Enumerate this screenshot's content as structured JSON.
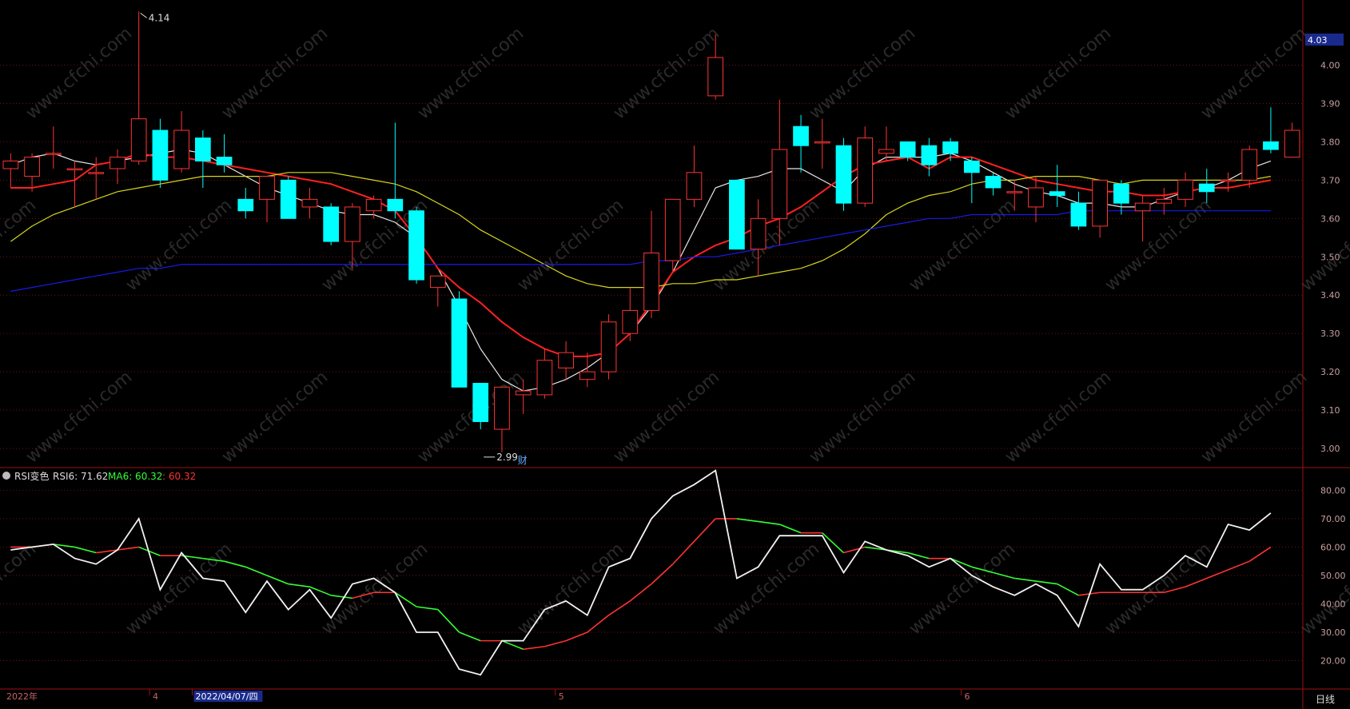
{
  "chart_data": {
    "type": "candlestick",
    "price_panel": {
      "ylim": [
        2.95,
        4.17
      ],
      "ticks": [
        4.0,
        3.9,
        3.8,
        3.7,
        3.6,
        3.5,
        3.4,
        3.3,
        3.2,
        3.1,
        3.0
      ],
      "tick_labels": [
        "4.00",
        "3.90",
        "3.80",
        "3.70",
        "3.60",
        "3.50",
        "3.40",
        "3.30",
        "3.20",
        "3.10",
        "3.00"
      ],
      "current_price_label": "4.03",
      "current_price": 4.03,
      "high_annotation": {
        "label": "4.14",
        "index": 6,
        "value": 4.14
      },
      "low_annotation": {
        "label": "2.99",
        "index": 22,
        "value": 2.99
      },
      "finance_marker": {
        "label": "财",
        "index": 24
      },
      "candles": [
        {
          "o": 3.73,
          "h": 3.77,
          "l": 3.68,
          "c": 3.75
        },
        {
          "o": 3.71,
          "h": 3.77,
          "l": 3.67,
          "c": 3.76
        },
        {
          "o": 3.77,
          "h": 3.84,
          "l": 3.73,
          "c": 3.77
        },
        {
          "o": 3.73,
          "h": 3.75,
          "l": 3.63,
          "c": 3.73
        },
        {
          "o": 3.72,
          "h": 3.76,
          "l": 3.65,
          "c": 3.72
        },
        {
          "o": 3.73,
          "h": 3.78,
          "l": 3.69,
          "c": 3.76
        },
        {
          "o": 3.75,
          "h": 4.14,
          "l": 3.74,
          "c": 3.86
        },
        {
          "o": 3.83,
          "h": 3.86,
          "l": 3.68,
          "c": 3.7
        },
        {
          "o": 3.73,
          "h": 3.88,
          "l": 3.72,
          "c": 3.83
        },
        {
          "o": 3.81,
          "h": 3.83,
          "l": 3.68,
          "c": 3.75
        },
        {
          "o": 3.76,
          "h": 3.82,
          "l": 3.72,
          "c": 3.74
        },
        {
          "o": 3.65,
          "h": 3.68,
          "l": 3.6,
          "c": 3.62
        },
        {
          "o": 3.65,
          "h": 3.71,
          "l": 3.59,
          "c": 3.71
        },
        {
          "o": 3.7,
          "h": 3.71,
          "l": 3.6,
          "c": 3.6
        },
        {
          "o": 3.63,
          "h": 3.68,
          "l": 3.6,
          "c": 3.65
        },
        {
          "o": 3.63,
          "h": 3.64,
          "l": 3.53,
          "c": 3.54
        },
        {
          "o": 3.54,
          "h": 3.64,
          "l": 3.47,
          "c": 3.63
        },
        {
          "o": 3.62,
          "h": 3.66,
          "l": 3.6,
          "c": 3.65
        },
        {
          "o": 3.65,
          "h": 3.85,
          "l": 3.6,
          "c": 3.62
        },
        {
          "o": 3.62,
          "h": 3.63,
          "l": 3.43,
          "c": 3.44
        },
        {
          "o": 3.42,
          "h": 3.45,
          "l": 3.37,
          "c": 3.45
        },
        {
          "o": 3.39,
          "h": 3.41,
          "l": 3.16,
          "c": 3.16
        },
        {
          "o": 3.17,
          "h": 3.16,
          "l": 3.05,
          "c": 3.07
        },
        {
          "o": 3.05,
          "h": 3.16,
          "l": 2.99,
          "c": 3.16
        },
        {
          "o": 3.14,
          "h": 3.18,
          "l": 3.09,
          "c": 3.15
        },
        {
          "o": 3.14,
          "h": 3.26,
          "l": 3.13,
          "c": 3.23
        },
        {
          "o": 3.21,
          "h": 3.28,
          "l": 3.18,
          "c": 3.25
        },
        {
          "o": 3.18,
          "h": 3.25,
          "l": 3.16,
          "c": 3.2
        },
        {
          "o": 3.2,
          "h": 3.35,
          "l": 3.18,
          "c": 3.33
        },
        {
          "o": 3.3,
          "h": 3.42,
          "l": 3.28,
          "c": 3.36
        },
        {
          "o": 3.36,
          "h": 3.62,
          "l": 3.34,
          "c": 3.51
        },
        {
          "o": 3.49,
          "h": 3.65,
          "l": 3.46,
          "c": 3.65
        },
        {
          "o": 3.65,
          "h": 3.79,
          "l": 3.63,
          "c": 3.72
        },
        {
          "o": 3.92,
          "h": 4.08,
          "l": 3.91,
          "c": 4.02
        },
        {
          "o": 3.7,
          "h": 3.7,
          "l": 3.52,
          "c": 3.52
        },
        {
          "o": 3.52,
          "h": 3.65,
          "l": 3.45,
          "c": 3.6
        },
        {
          "o": 3.6,
          "h": 3.91,
          "l": 3.53,
          "c": 3.78
        },
        {
          "o": 3.84,
          "h": 3.87,
          "l": 3.72,
          "c": 3.79
        },
        {
          "o": 3.8,
          "h": 3.86,
          "l": 3.73,
          "c": 3.8
        },
        {
          "o": 3.79,
          "h": 3.81,
          "l": 3.62,
          "c": 3.64
        },
        {
          "o": 3.64,
          "h": 3.84,
          "l": 3.63,
          "c": 3.81
        },
        {
          "o": 3.77,
          "h": 3.84,
          "l": 3.75,
          "c": 3.78
        },
        {
          "o": 3.8,
          "h": 3.8,
          "l": 3.75,
          "c": 3.76
        },
        {
          "o": 3.79,
          "h": 3.81,
          "l": 3.71,
          "c": 3.74
        },
        {
          "o": 3.8,
          "h": 3.81,
          "l": 3.75,
          "c": 3.77
        },
        {
          "o": 3.75,
          "h": 3.76,
          "l": 3.64,
          "c": 3.72
        },
        {
          "o": 3.71,
          "h": 3.72,
          "l": 3.66,
          "c": 3.68
        },
        {
          "o": 3.67,
          "h": 3.7,
          "l": 3.62,
          "c": 3.67
        },
        {
          "o": 3.63,
          "h": 3.71,
          "l": 3.59,
          "c": 3.68
        },
        {
          "o": 3.67,
          "h": 3.74,
          "l": 3.63,
          "c": 3.66
        },
        {
          "o": 3.64,
          "h": 3.67,
          "l": 3.57,
          "c": 3.58
        },
        {
          "o": 3.58,
          "h": 3.7,
          "l": 3.55,
          "c": 3.7
        },
        {
          "o": 3.69,
          "h": 3.7,
          "l": 3.61,
          "c": 3.64
        },
        {
          "o": 3.62,
          "h": 3.66,
          "l": 3.54,
          "c": 3.64
        },
        {
          "o": 3.64,
          "h": 3.68,
          "l": 3.61,
          "c": 3.65
        },
        {
          "o": 3.65,
          "h": 3.72,
          "l": 3.63,
          "c": 3.7
        },
        {
          "o": 3.69,
          "h": 3.73,
          "l": 3.64,
          "c": 3.67
        },
        {
          "o": 3.7,
          "h": 3.72,
          "l": 3.67,
          "c": 3.7
        },
        {
          "o": 3.7,
          "h": 3.79,
          "l": 3.68,
          "c": 3.78
        },
        {
          "o": 3.8,
          "h": 3.89,
          "l": 3.77,
          "c": 3.78
        },
        {
          "o": 3.76,
          "h": 3.85,
          "l": 3.76,
          "c": 3.83
        }
      ],
      "ma_lines": [
        {
          "name": "MA-white",
          "color": "#e6e6e6",
          "values": [
            3.74,
            3.76,
            3.77,
            3.75,
            3.74,
            3.75,
            3.76,
            3.77,
            3.78,
            3.77,
            3.74,
            3.71,
            3.68,
            3.66,
            3.64,
            3.62,
            3.61,
            3.61,
            3.59,
            3.55,
            3.47,
            3.37,
            3.26,
            3.18,
            3.15,
            3.16,
            3.18,
            3.21,
            3.25,
            3.3,
            3.37,
            3.46,
            3.57,
            3.68,
            3.7,
            3.71,
            3.73,
            3.73,
            3.7,
            3.67,
            3.73,
            3.76,
            3.76,
            3.76,
            3.77,
            3.75,
            3.72,
            3.69,
            3.67,
            3.66,
            3.64,
            3.64,
            3.63,
            3.63,
            3.65,
            3.67,
            3.68,
            3.7,
            3.73,
            3.75
          ]
        },
        {
          "name": "MA-red",
          "color": "#ff2020",
          "values": [
            3.68,
            3.68,
            3.69,
            3.7,
            3.74,
            3.75,
            3.77,
            3.76,
            3.76,
            3.75,
            3.74,
            3.73,
            3.72,
            3.71,
            3.7,
            3.69,
            3.67,
            3.65,
            3.62,
            3.55,
            3.47,
            3.42,
            3.38,
            3.33,
            3.29,
            3.26,
            3.24,
            3.24,
            3.25,
            3.3,
            3.38,
            3.46,
            3.5,
            3.53,
            3.55,
            3.58,
            3.6,
            3.63,
            3.67,
            3.71,
            3.74,
            3.75,
            3.76,
            3.73,
            3.76,
            3.76,
            3.74,
            3.72,
            3.7,
            3.69,
            3.68,
            3.67,
            3.67,
            3.66,
            3.66,
            3.67,
            3.68,
            3.68,
            3.69,
            3.7
          ]
        },
        {
          "name": "MA-yellow",
          "color": "#d6d61a",
          "values": [
            3.54,
            3.58,
            3.61,
            3.63,
            3.65,
            3.67,
            3.68,
            3.69,
            3.7,
            3.71,
            3.71,
            3.71,
            3.71,
            3.72,
            3.72,
            3.72,
            3.71,
            3.7,
            3.69,
            3.67,
            3.64,
            3.61,
            3.57,
            3.54,
            3.51,
            3.48,
            3.45,
            3.43,
            3.42,
            3.42,
            3.42,
            3.43,
            3.43,
            3.44,
            3.44,
            3.45,
            3.46,
            3.47,
            3.49,
            3.52,
            3.56,
            3.61,
            3.64,
            3.66,
            3.67,
            3.69,
            3.7,
            3.7,
            3.71,
            3.71,
            3.71,
            3.7,
            3.69,
            3.7,
            3.7,
            3.7,
            3.7,
            3.7,
            3.7,
            3.71
          ]
        },
        {
          "name": "MA-blue",
          "color": "#1a1ae6",
          "values": [
            3.41,
            3.42,
            3.43,
            3.44,
            3.45,
            3.46,
            3.47,
            3.47,
            3.48,
            3.48,
            3.48,
            3.48,
            3.48,
            3.48,
            3.48,
            3.48,
            3.48,
            3.48,
            3.48,
            3.48,
            3.48,
            3.48,
            3.48,
            3.48,
            3.48,
            3.48,
            3.48,
            3.48,
            3.48,
            3.48,
            3.49,
            3.49,
            3.5,
            3.5,
            3.51,
            3.52,
            3.53,
            3.54,
            3.55,
            3.56,
            3.57,
            3.58,
            3.59,
            3.6,
            3.6,
            3.61,
            3.61,
            3.61,
            3.61,
            3.61,
            3.62,
            3.62,
            3.62,
            3.62,
            3.62,
            3.62,
            3.62,
            3.62,
            3.62,
            3.62
          ]
        }
      ]
    },
    "rsi_panel": {
      "legend_name": "RSI变色",
      "legend_rsi": "RSI6: 71.62",
      "legend_ma": "MA6: 60.32",
      "legend_extra": ": 60.32",
      "ylim": [
        10,
        88
      ],
      "ticks": [
        80,
        70,
        60,
        50,
        40,
        30,
        20
      ],
      "tick_labels": [
        "80.00",
        "70.00",
        "60.00",
        "50.00",
        "40.00",
        "30.00",
        "20.00"
      ],
      "rsi": [
        59,
        60,
        61,
        56,
        54,
        59,
        70,
        45,
        58,
        49,
        48,
        37,
        48,
        38,
        45,
        35,
        47,
        49,
        44,
        30,
        30,
        17,
        15,
        27,
        27,
        38,
        41,
        36,
        53,
        56,
        70,
        78,
        82,
        87,
        49,
        53,
        64,
        64,
        64,
        51,
        62,
        59,
        57,
        53,
        56,
        50,
        46,
        43,
        47,
        43,
        32,
        54,
        45,
        45,
        50,
        57,
        53,
        68,
        66,
        72
      ],
      "ma": [
        60,
        60,
        61,
        60,
        58,
        59,
        60,
        57,
        57,
        56,
        55,
        53,
        50,
        47,
        46,
        43,
        42,
        44,
        44,
        39,
        38,
        30,
        27,
        27,
        24,
        25,
        27,
        30,
        36,
        41,
        47,
        54,
        62,
        70,
        70,
        69,
        68,
        65,
        65,
        58,
        60,
        59,
        58,
        56,
        56,
        53,
        51,
        49,
        48,
        47,
        43,
        44,
        44,
        44,
        44,
        46,
        49,
        52,
        55,
        60
      ]
    },
    "x_axis": {
      "labels": [
        {
          "text": "2022年",
          "index": 0
        },
        {
          "text": "4",
          "index": 7
        },
        {
          "text": "2022/04/07/四",
          "index": 9
        },
        {
          "text": "5",
          "index": 26
        },
        {
          "text": "6",
          "index": 45
        }
      ]
    },
    "period_label": "日线"
  },
  "watermark": "www.cfchi.com",
  "colors": {
    "up": "#ff3333",
    "down": "#00ffff",
    "grid": "#6e1010",
    "axis_text": "#c8a0a0",
    "legend_green": "#33ff33",
    "legend_red": "#ff3333"
  }
}
